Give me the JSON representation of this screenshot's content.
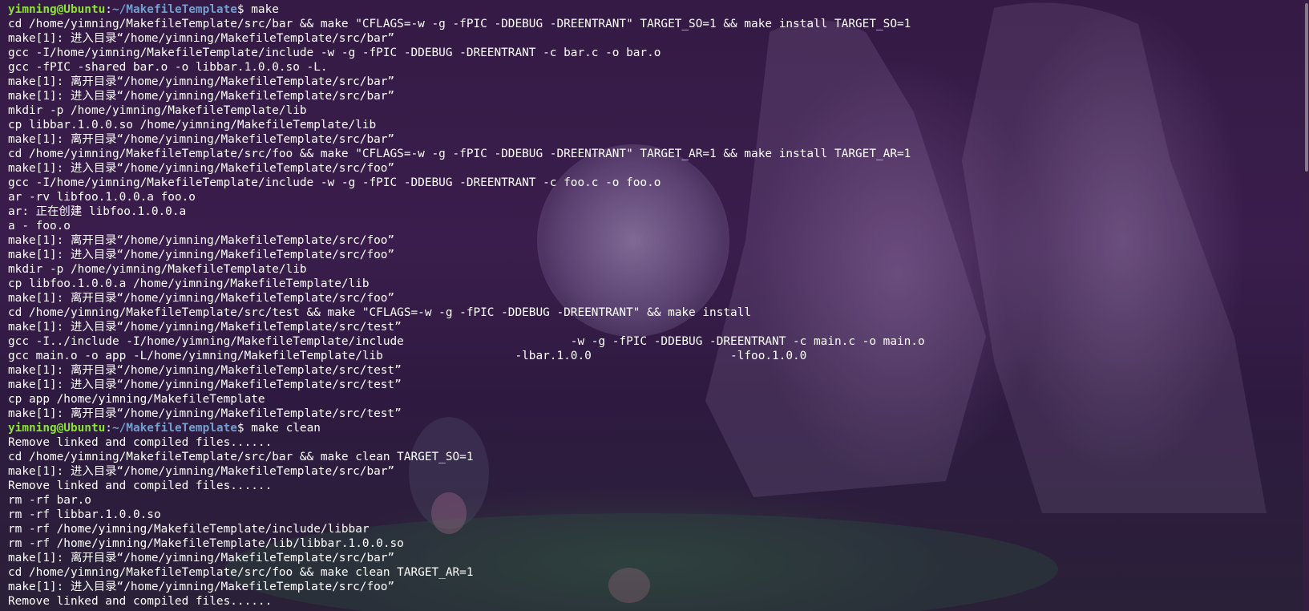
{
  "prompt": {
    "user_host": "yimning@Ubuntu",
    "path": "~/MakefileTemplate",
    "symbol": "$"
  },
  "lines": [
    {
      "type": "prompt",
      "command": " make"
    },
    {
      "type": "text",
      "text": "cd /home/yimning/MakefileTemplate/src/bar && make \"CFLAGS=-w -g -fPIC -DDEBUG -DREENTRANT\" TARGET_SO=1 && make install TARGET_SO=1"
    },
    {
      "type": "text",
      "text": "make[1]: 进入目录“/home/yimning/MakefileTemplate/src/bar”"
    },
    {
      "type": "text",
      "text": "gcc -I/home/yimning/MakefileTemplate/include -w -g -fPIC -DDEBUG -DREENTRANT -c bar.c -o bar.o"
    },
    {
      "type": "text",
      "text": "gcc -fPIC -shared bar.o -o libbar.1.0.0.so -L."
    },
    {
      "type": "text",
      "text": "make[1]: 离开目录“/home/yimning/MakefileTemplate/src/bar”"
    },
    {
      "type": "text",
      "text": "make[1]: 进入目录“/home/yimning/MakefileTemplate/src/bar”"
    },
    {
      "type": "text",
      "text": "mkdir -p /home/yimning/MakefileTemplate/lib"
    },
    {
      "type": "text",
      "text": "cp libbar.1.0.0.so /home/yimning/MakefileTemplate/lib"
    },
    {
      "type": "text",
      "text": "make[1]: 离开目录“/home/yimning/MakefileTemplate/src/bar”"
    },
    {
      "type": "text",
      "text": "cd /home/yimning/MakefileTemplate/src/foo && make \"CFLAGS=-w -g -fPIC -DDEBUG -DREENTRANT\" TARGET_AR=1 && make install TARGET_AR=1"
    },
    {
      "type": "text",
      "text": "make[1]: 进入目录“/home/yimning/MakefileTemplate/src/foo”"
    },
    {
      "type": "text",
      "text": "gcc -I/home/yimning/MakefileTemplate/include -w -g -fPIC -DDEBUG -DREENTRANT -c foo.c -o foo.o"
    },
    {
      "type": "text",
      "text": "ar -rv libfoo.1.0.0.a foo.o"
    },
    {
      "type": "text",
      "text": "ar: 正在创建 libfoo.1.0.0.a"
    },
    {
      "type": "text",
      "text": "a - foo.o"
    },
    {
      "type": "text",
      "text": "make[1]: 离开目录“/home/yimning/MakefileTemplate/src/foo”"
    },
    {
      "type": "text",
      "text": "make[1]: 进入目录“/home/yimning/MakefileTemplate/src/foo”"
    },
    {
      "type": "text",
      "text": "mkdir -p /home/yimning/MakefileTemplate/lib"
    },
    {
      "type": "text",
      "text": "cp libfoo.1.0.0.a /home/yimning/MakefileTemplate/lib"
    },
    {
      "type": "text",
      "text": "make[1]: 离开目录“/home/yimning/MakefileTemplate/src/foo”"
    },
    {
      "type": "text",
      "text": "cd /home/yimning/MakefileTemplate/src/test && make \"CFLAGS=-w -g -fPIC -DDEBUG -DREENTRANT\" && make install"
    },
    {
      "type": "text",
      "text": "make[1]: 进入目录“/home/yimning/MakefileTemplate/src/test”"
    },
    {
      "type": "text",
      "text": "gcc -I../include -I/home/yimning/MakefileTemplate/include                        -w -g -fPIC -DDEBUG -DREENTRANT -c main.c -o main.o"
    },
    {
      "type": "text",
      "text": "gcc main.o -o app -L/home/yimning/MakefileTemplate/lib                   -lbar.1.0.0                    -lfoo.1.0.0"
    },
    {
      "type": "text",
      "text": "make[1]: 离开目录“/home/yimning/MakefileTemplate/src/test”"
    },
    {
      "type": "text",
      "text": "make[1]: 进入目录“/home/yimning/MakefileTemplate/src/test”"
    },
    {
      "type": "text",
      "text": "cp app /home/yimning/MakefileTemplate"
    },
    {
      "type": "text",
      "text": "make[1]: 离开目录“/home/yimning/MakefileTemplate/src/test”"
    },
    {
      "type": "prompt",
      "command": " make clean"
    },
    {
      "type": "text",
      "text": "Remove linked and compiled files......"
    },
    {
      "type": "text",
      "text": "cd /home/yimning/MakefileTemplate/src/bar && make clean TARGET_SO=1"
    },
    {
      "type": "text",
      "text": "make[1]: 进入目录“/home/yimning/MakefileTemplate/src/bar”"
    },
    {
      "type": "text",
      "text": "Remove linked and compiled files......"
    },
    {
      "type": "text",
      "text": "rm -rf bar.o"
    },
    {
      "type": "text",
      "text": "rm -rf libbar.1.0.0.so"
    },
    {
      "type": "text",
      "text": "rm -rf /home/yimning/MakefileTemplate/include/libbar"
    },
    {
      "type": "text",
      "text": "rm -rf /home/yimning/MakefileTemplate/lib/libbar.1.0.0.so"
    },
    {
      "type": "text",
      "text": "make[1]: 离开目录“/home/yimning/MakefileTemplate/src/bar”"
    },
    {
      "type": "text",
      "text": "cd /home/yimning/MakefileTemplate/src/foo && make clean TARGET_AR=1"
    },
    {
      "type": "text",
      "text": "make[1]: 进入目录“/home/yimning/MakefileTemplate/src/foo”"
    },
    {
      "type": "text",
      "text": "Remove linked and compiled files......"
    }
  ],
  "colors": {
    "prompt_user": "#8ae234",
    "prompt_path": "#729fcf",
    "text": "#ffffff",
    "background": "#351a45"
  }
}
